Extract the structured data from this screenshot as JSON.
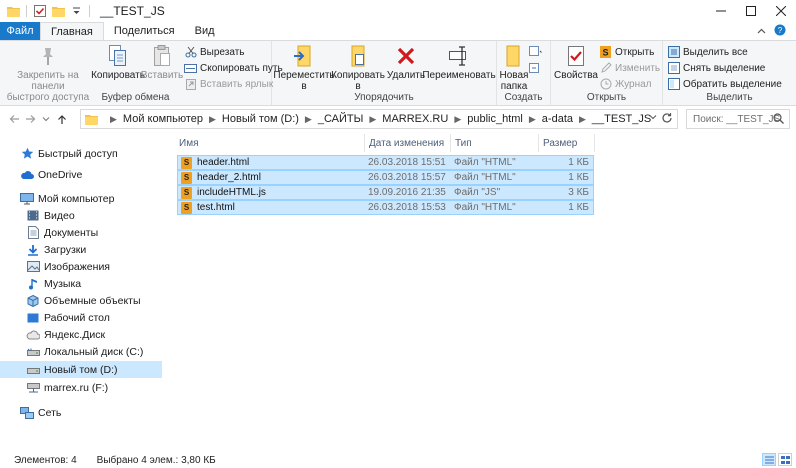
{
  "window": {
    "title": "__TEST_JS"
  },
  "tabs": [
    {
      "label": "Файл"
    },
    {
      "label": "Главная"
    },
    {
      "label": "Поделиться"
    },
    {
      "label": "Вид"
    }
  ],
  "ribbon": {
    "clipboard": {
      "label": "Буфер обмена",
      "pin": "Закрепить на панели быстрого доступа",
      "pin_l1": "Закрепить на панели",
      "pin_l2": "быстрого доступа",
      "copy": "Копировать",
      "paste": "Вставить",
      "cut": "Вырезать",
      "copy_path": "Скопировать путь",
      "paste_shortcut": "Вставить ярлык"
    },
    "organize": {
      "label": "Упорядочить",
      "move_l1": "Переместить",
      "move_l2": "в",
      "copy_l1": "Копировать",
      "copy_l2": "в",
      "delete": "Удалить",
      "rename": "Переименовать"
    },
    "new": {
      "label": "Создать",
      "folder_l1": "Новая",
      "folder_l2": "папка"
    },
    "open": {
      "label": "Открыть",
      "properties": "Свойства",
      "open": "Открыть",
      "edit": "Изменить",
      "history": "Журнал"
    },
    "select": {
      "label": "Выделить",
      "select_all": "Выделить все",
      "select_none": "Снять выделение",
      "invert": "Обратить выделение"
    }
  },
  "address": {
    "crumbs": [
      "Мой компьютер",
      "Новый том (D:)",
      "_САЙТЫ",
      "MARREX.RU",
      "public_html",
      "a-data",
      "__TEST_JS"
    ],
    "search_placeholder": "Поиск: __TEST_JS"
  },
  "sidebar": {
    "items": [
      {
        "label": "Быстрый доступ",
        "icon": "star-icon"
      },
      {
        "label": "OneDrive",
        "icon": "cloud-icon"
      },
      {
        "label": "Мой компьютер",
        "icon": "computer-icon"
      },
      {
        "label": "Видео",
        "icon": "video-icon"
      },
      {
        "label": "Документы",
        "icon": "documents-icon"
      },
      {
        "label": "Загрузки",
        "icon": "download-icon"
      },
      {
        "label": "Изображения",
        "icon": "images-icon"
      },
      {
        "label": "Музыка",
        "icon": "music-icon"
      },
      {
        "label": "Объемные объекты",
        "icon": "3d-objects-icon"
      },
      {
        "label": "Рабочий стол",
        "icon": "desktop-icon"
      },
      {
        "label": "Яндекс.Диск",
        "icon": "yandex-disk-icon"
      },
      {
        "label": "Локальный диск (C:)",
        "icon": "drive-icon"
      },
      {
        "label": "Новый том (D:)",
        "icon": "drive-icon"
      },
      {
        "label": "marrex.ru (F:)",
        "icon": "network-drive-icon"
      },
      {
        "label": "Сеть",
        "icon": "network-icon"
      }
    ]
  },
  "filelist": {
    "columns": {
      "name": "Имя",
      "date": "Дата изменения",
      "type": "Тип",
      "size": "Размер"
    },
    "rows": [
      {
        "name": "header.html",
        "date": "26.03.2018 15:51",
        "type": "Файл \"HTML\"",
        "size": "1 КБ"
      },
      {
        "name": "header_2.html",
        "date": "26.03.2018 15:57",
        "type": "Файл \"HTML\"",
        "size": "1 КБ"
      },
      {
        "name": "includeHTML.js",
        "date": "19.09.2016 21:35",
        "type": "Файл \"JS\"",
        "size": "3 КБ"
      },
      {
        "name": "test.html",
        "date": "26.03.2018 15:53",
        "type": "Файл \"HTML\"",
        "size": "1 КБ"
      }
    ]
  },
  "status": {
    "count": "Элементов: 4",
    "selected": "Выбрано 4 элем.: 3,80 КБ"
  }
}
